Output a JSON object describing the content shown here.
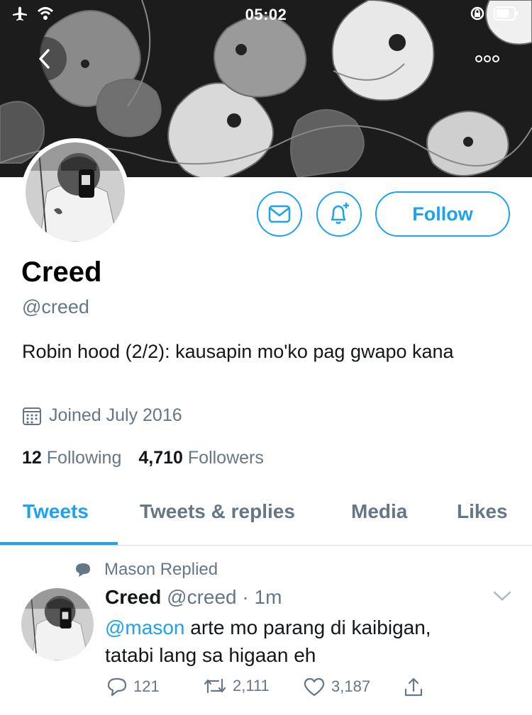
{
  "status_bar": {
    "time": "05:02"
  },
  "profile": {
    "display_name": "Creed",
    "handle": "@creed",
    "bio": "Robin hood (2/2): kausapin mo'ko pag gwapo kana",
    "joined": "Joined July 2016",
    "following_count": "12",
    "following_label": "Following",
    "followers_count": "4,710",
    "followers_label": "Followers",
    "follow_label": "Follow"
  },
  "tabs": [
    {
      "label": "Tweets",
      "active": true
    },
    {
      "label": "Tweets & replies",
      "active": false
    },
    {
      "label": "Media",
      "active": false
    },
    {
      "label": "Likes",
      "active": false
    }
  ],
  "tweet": {
    "context": "Mason Replied",
    "name": "Creed",
    "handle": "@creed",
    "separator": "·",
    "time": "1m",
    "mention": "@mason",
    "text_line1_rest": " arte mo parang di kaibigan,",
    "text_line2": "tatabi lang sa higaan eh",
    "replies": "121",
    "retweets": "2,111",
    "likes": "3,187"
  },
  "colors": {
    "accent": "#1da1f2",
    "muted": "#657786",
    "text": "#14171a"
  }
}
